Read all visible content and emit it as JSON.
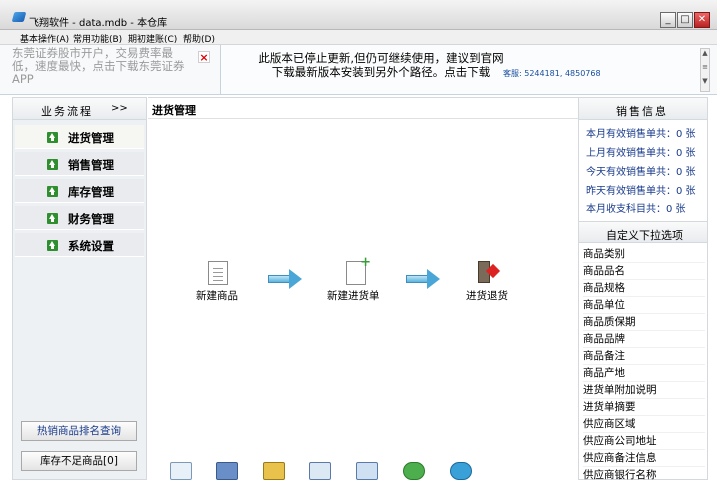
{
  "window": {
    "title": "飞翔软件 - data.mdb - 本仓库",
    "min_label": "_",
    "max_label": "□",
    "close_label": "✕"
  },
  "menu": {
    "items": [
      "基本操作(A)",
      "常用功能(B)",
      "期初建账(C)",
      "帮助(D)"
    ]
  },
  "banner": {
    "ad_text": "东莞证券股市开户，交易费率最低，速度最快，点击下载东莞证券APP",
    "ad_close": "×",
    "notice": "此版本已停止更新,但仍可继续使用，建议到官网下载最新版本安装到另外个路径。点击下载",
    "contact": "客服: 5244181, 4850768",
    "scroll_up": "▲",
    "scroll_thumb": "≡",
    "scroll_down": "▼"
  },
  "left": {
    "header": "业务流程",
    "header_arrow": ">>",
    "nav_items": [
      "进货管理",
      "销售管理",
      "库存管理",
      "财务管理",
      "系统设置"
    ],
    "hot_button": "热销商品排名查询",
    "stock_button": "库存不足商品[0]"
  },
  "center": {
    "title": "进货管理",
    "flow": {
      "new_product": "新建商品",
      "new_purchase": "新建进货单",
      "purchase_return": "进货退货"
    }
  },
  "right": {
    "sales_header": "销售信息",
    "sales_lines": [
      "本月有效销售单共：0 张",
      "上月有效销售单共：0 张",
      "今天有效销售单共：0 张",
      "昨天有效销售单共：0 张",
      "本月收支科目共：0 张"
    ],
    "custom_header": "自定义下拉选项",
    "custom_items": [
      "商品类别",
      "商品品名",
      "商品规格",
      "商品单位",
      "商品质保期",
      "商品品牌",
      "商品备注",
      "商品产地",
      "进货单附加说明",
      "进货单摘要",
      "供应商区域",
      "供应商公司地址",
      "供应商备注信息",
      "供应商银行名称"
    ]
  },
  "colors": {
    "accent_blue": "#1a3c8c",
    "nav_icon_green": "#2f8f2f",
    "flow_arrow": "#4aa6d6"
  }
}
